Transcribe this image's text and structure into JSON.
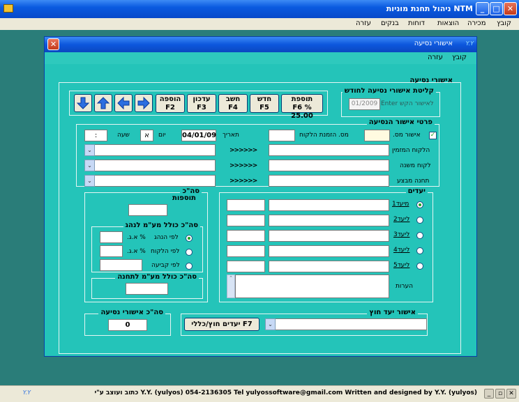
{
  "window": {
    "title": "ניהול תחנת מוניות NTM"
  },
  "menubar": [
    "קובץ",
    "מכירה",
    "הוצאות",
    "דוחות",
    "בנקים",
    "עזרה"
  ],
  "child": {
    "title": "אישורי נסיעה",
    "title_prefix": "Y.Y",
    "menu": [
      "קובץ",
      "עזרה"
    ]
  },
  "form": {
    "section_title": "אישורי נסיעה",
    "import_group": {
      "legend": "קליטת אישורי נסיעה לחודש",
      "hint": "לאישור הקש Enter",
      "month_value": "01/2009"
    },
    "toolbar": {
      "buttons": [
        {
          "line1": "תוספת",
          "line2": "F6 % 25.00"
        },
        {
          "line1": "חדש",
          "line2": "F5"
        },
        {
          "line1": "חשב",
          "line2": "F4"
        },
        {
          "line1": "עדכון",
          "line2": "F3"
        },
        {
          "line1": "הוספה",
          "line2": "F2"
        }
      ]
    },
    "details_group": {
      "legend": "פרטי אישור הנסיעה",
      "approval_no_label": "אישור מס.",
      "order_no_label": "מס. הזמנת הלקוח",
      "date_label": "תאריך",
      "date_value": "04/01/09",
      "day_label": "יום",
      "day_value": "א",
      "time_label": "שעה",
      "time_value": ":",
      "ordering_client_label": "הלקוח המזמין",
      "sub_client_label": "לקוח משנה",
      "station_label": "תחנה מבצע",
      "arrows": ">>>>>>"
    },
    "totals_group": {
      "legend": "סה\"כ",
      "addition_label": "תוספות",
      "vat_driver_legend": "סה\"כ כולל מע\"מ לנהג",
      "by_driver_label": "לפי הנהג",
      "by_client_label": "לפי הלקוח",
      "fixed_label": "לפי קביעה",
      "pct_label": "% א.ג.",
      "vat_station_legend": "סה\"כ כולל מע\"מ לתחנה"
    },
    "destinations_group": {
      "legend": "יעדים",
      "items": [
        "מיעד1",
        "ליעד2",
        "ליעד3",
        "ליעד4",
        "ליעד5"
      ],
      "notes_label": "הערות"
    },
    "total_approvals": {
      "legend": "סה\"כ אישורי נסיעה",
      "value": "0"
    },
    "abroad_group": {
      "legend": "אישור יעד חוץ",
      "button_label": "יעדים חוץ/כללי F7"
    }
  },
  "statusbar": {
    "text": "כתוב ועוצב ע\"י Y.Y.  (yulyos) 054-2136305 Tel  yulyossoftware@gmail.com  Written and designed by Y.Y. (yulyos)",
    "prefix": "Y.Y"
  }
}
